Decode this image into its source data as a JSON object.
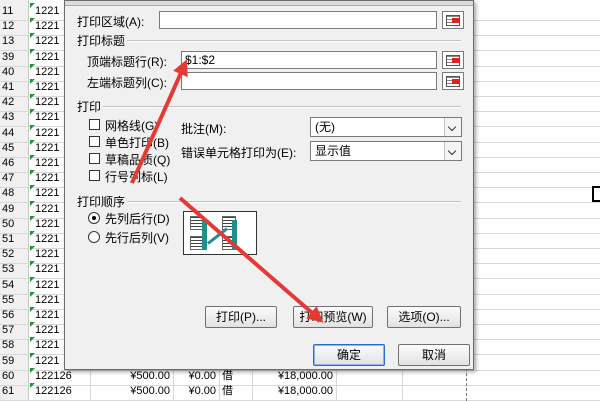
{
  "sheet": {
    "rows": [
      {
        "n": "11",
        "a": "1221"
      },
      {
        "n": "12",
        "a": "1221"
      },
      {
        "n": "13",
        "a": "1221"
      },
      {
        "n": "39",
        "a": "1221"
      },
      {
        "n": "40",
        "a": "1221"
      },
      {
        "n": "41",
        "a": "1221"
      },
      {
        "n": "42",
        "a": "1221"
      },
      {
        "n": "43",
        "a": "1221"
      },
      {
        "n": "44",
        "a": "1221"
      },
      {
        "n": "45",
        "a": "1221"
      },
      {
        "n": "46",
        "a": "1221"
      },
      {
        "n": "47",
        "a": "1221"
      },
      {
        "n": "48",
        "a": "1221"
      },
      {
        "n": "49",
        "a": "1221"
      },
      {
        "n": "50",
        "a": "1221"
      },
      {
        "n": "51",
        "a": "1221"
      },
      {
        "n": "52",
        "a": "1221"
      },
      {
        "n": "53",
        "a": "1221"
      },
      {
        "n": "54",
        "a": "1221"
      },
      {
        "n": "55",
        "a": "1221"
      },
      {
        "n": "56",
        "a": "1221"
      },
      {
        "n": "57",
        "a": "1221"
      },
      {
        "n": "58",
        "a": "1221"
      },
      {
        "n": "59",
        "a": "1221"
      },
      {
        "n": "60",
        "a": "122126",
        "c": "¥500.00",
        "d": "¥0.00",
        "e": "借",
        "f": "¥18,000.00"
      },
      {
        "n": "61",
        "a": "122126",
        "c": "¥500.00",
        "d": "¥0.00",
        "e": "借",
        "f": "¥18,000.00"
      }
    ]
  },
  "dialog": {
    "print_area_label": "打印区域(A):",
    "print_area_value": "",
    "print_titles_section": "打印标题",
    "top_rows_label": "顶端标题行(R):",
    "top_rows_value": "$1:$2",
    "left_cols_label": "左端标题列(C):",
    "left_cols_value": "",
    "print_section": "打印",
    "checkboxes": [
      "网格线(G)",
      "单色打印(B)",
      "草稿品质(Q)",
      "行号列标(L)"
    ],
    "comments_label": "批注(M):",
    "comments_value": "(无)",
    "errors_label": "错误单元格打印为(E):",
    "errors_value": "显示值",
    "order_section": "打印顺序",
    "order_options": [
      "先列后行(D)",
      "先行后列(V)"
    ],
    "buttons": {
      "print": "打印(P)...",
      "preview": "打印预览(W)",
      "options": "选项(O)...",
      "ok": "确定",
      "cancel": "取消"
    }
  },
  "colors": {
    "arrow": "#e53935",
    "accent": "#2c6ad6"
  },
  "icons": [
    "collapse-dialog-icon",
    "page-order-icon",
    "dropdown-arrow-icon"
  ]
}
